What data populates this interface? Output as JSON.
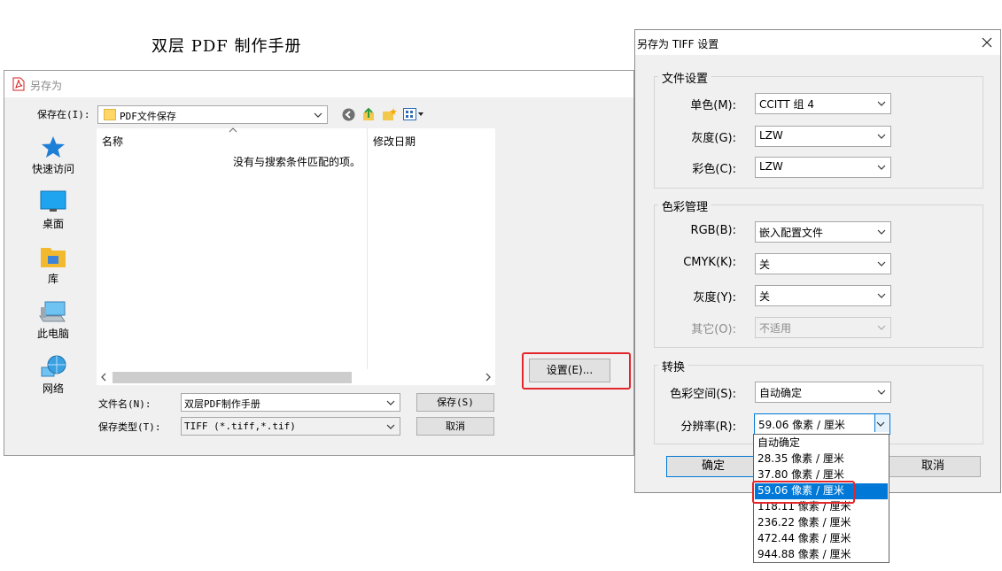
{
  "doc_title": "双层 PDF 制作手册",
  "save_dialog": {
    "title": "另存为",
    "save_in_label": "保存在(I):",
    "save_in_value": "PDF文件保存",
    "places": [
      {
        "label": "快速访问"
      },
      {
        "label": "桌面"
      },
      {
        "label": "库"
      },
      {
        "label": "此电脑"
      },
      {
        "label": "网络"
      }
    ],
    "columns": {
      "name": "名称",
      "date": "修改日期"
    },
    "empty_message": "没有与搜索条件匹配的项。",
    "settings_button": "设置(E)...",
    "filename_label": "文件名(N):",
    "filename_value": "双层PDF制作手册",
    "filetype_label": "保存类型(T):",
    "filetype_value": "TIFF (*.tiff,*.tif)",
    "save_button": "保存(S)",
    "cancel_button": "取消"
  },
  "tiff_dialog": {
    "title": "另存为 TIFF 设置",
    "file_settings": {
      "legend": "文件设置",
      "mono_label": "单色(M):",
      "mono_value": "CCITT 组 4",
      "gray_label": "灰度(G):",
      "gray_value": "LZW",
      "color_label": "彩色(C):",
      "color_value": "LZW"
    },
    "color_management": {
      "legend": "色彩管理",
      "rgb_label": "RGB(B):",
      "rgb_value": "嵌入配置文件",
      "cmyk_label": "CMYK(K):",
      "cmyk_value": "关",
      "gray_label": "灰度(Y):",
      "gray_value": "关",
      "other_label": "其它(O):",
      "other_value": "不适用"
    },
    "conversion": {
      "legend": "转换",
      "colorspace_label": "色彩空间(S):",
      "colorspace_value": "自动确定",
      "resolution_label": "分辨率(R):",
      "resolution_value": "59.06 像素 / 厘米"
    },
    "resolution_options": [
      "自动确定",
      "28.35 像素 / 厘米",
      "37.80 像素 / 厘米",
      "59.06 像素 / 厘米",
      "118.11 像素 / 厘米",
      "236.22 像素 / 厘米",
      "472.44 像素 / 厘米",
      "944.88 像素 / 厘米"
    ],
    "selected_option": "59.06 像素 / 厘米",
    "ok_button": "确定",
    "cancel_button": "取消"
  },
  "colors": {
    "highlight": "#e3262b",
    "selection": "#0078d7",
    "folder": "#ffd766",
    "pdf_red": "#d62020"
  }
}
